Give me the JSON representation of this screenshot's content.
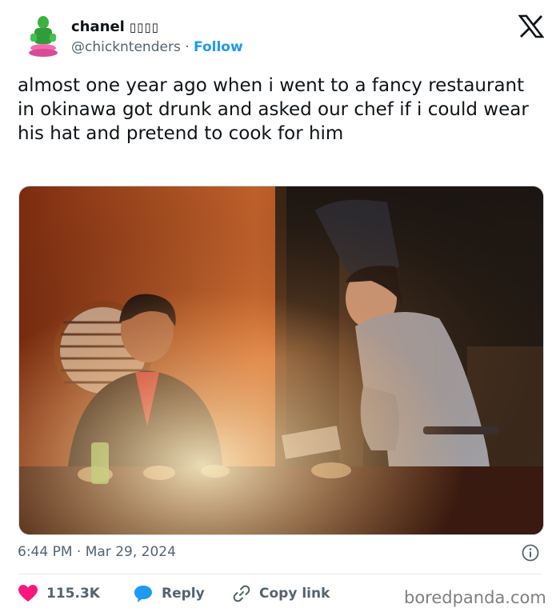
{
  "author": {
    "name": "chanel",
    "name_glyphs": "▯▯▯▯",
    "handle": "@chickntenders",
    "separator": "·",
    "follow_label": "Follow"
  },
  "tweet": {
    "text": "almost one year ago when i went to a fancy restaurant in okinawa got drunk and asked our chef if i could wear his hat and pretend to cook for him"
  },
  "meta": {
    "time": "6:44 PM",
    "separator": "·",
    "date": "Mar 29, 2024"
  },
  "actions": {
    "likes": "115.3K",
    "reply_label": "Reply",
    "copy_label": "Copy link"
  },
  "watermark": "boredpanda.com",
  "colors": {
    "accent": "#1d9bf0",
    "like": "#f91880",
    "text": "#0f1419",
    "muted": "#536471"
  },
  "icons": [
    "x-logo-icon",
    "info-icon",
    "heart-icon",
    "reply-bubble-icon",
    "link-icon"
  ]
}
